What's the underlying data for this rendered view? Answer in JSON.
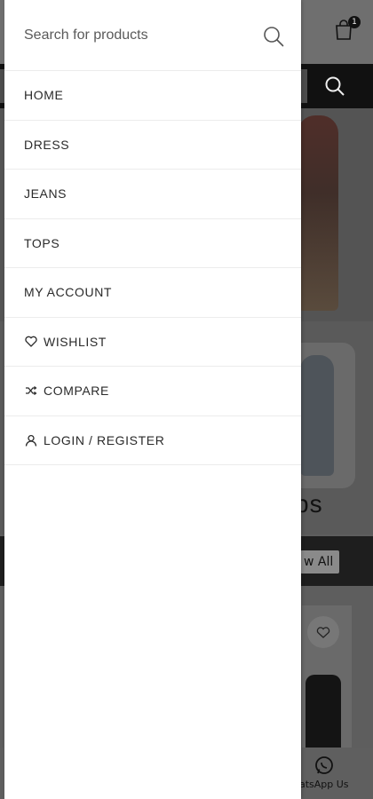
{
  "drawer": {
    "search": {
      "placeholder": "Search for products",
      "icon": "search-icon"
    },
    "items": [
      {
        "label": "HOME",
        "icon": null
      },
      {
        "label": "DRESS",
        "icon": null
      },
      {
        "label": "JEANS",
        "icon": null
      },
      {
        "label": "TOPS",
        "icon": null
      },
      {
        "label": "MY ACCOUNT",
        "icon": null
      },
      {
        "label": "WISHLIST",
        "icon": "heart-icon"
      },
      {
        "label": "COMPARE",
        "icon": "shuffle-icon"
      },
      {
        "label": "LOGIN / REGISTER",
        "icon": "user-icon"
      }
    ]
  },
  "background": {
    "cart_count": "1",
    "section_title": "ps",
    "view_all_label": "w All",
    "footer_label": "hatsApp Us"
  },
  "colors": {
    "drawer_bg": "#ffffff",
    "overlay_dim": "#5e5e5e",
    "text": "#2a2a2a",
    "divider": "#ececec"
  }
}
